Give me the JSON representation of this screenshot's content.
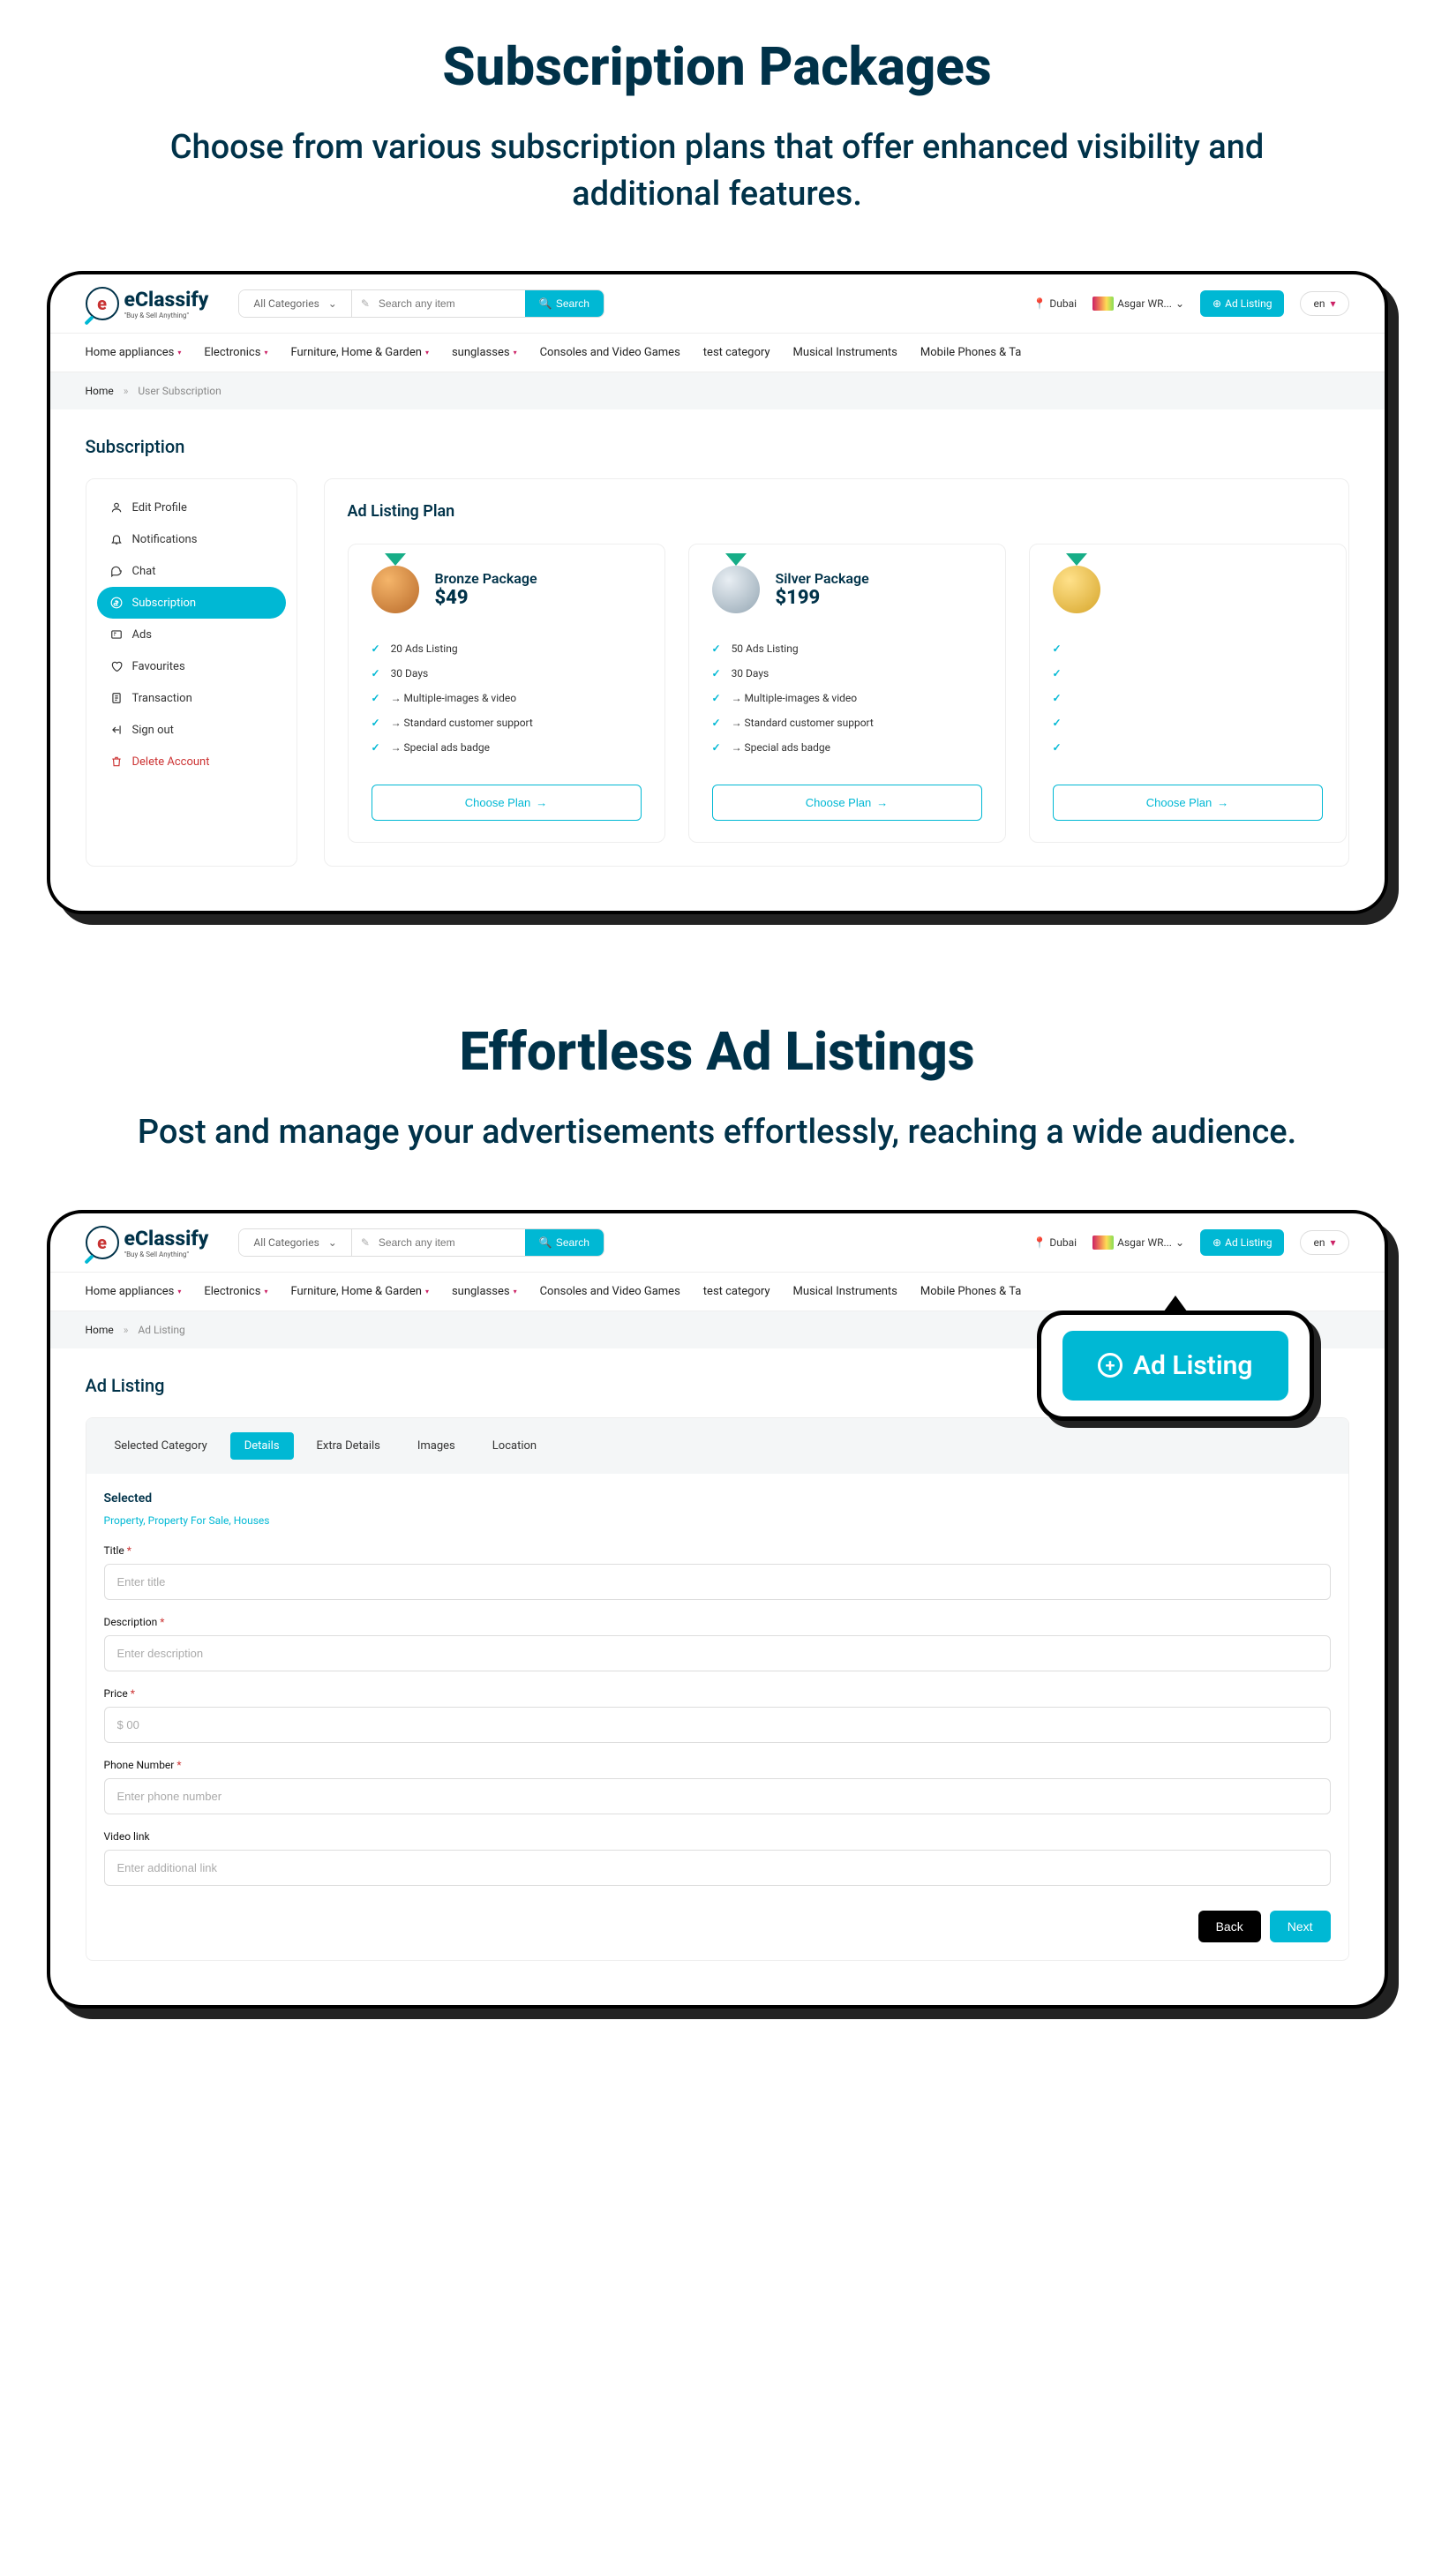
{
  "section1": {
    "title": "Subscription Packages",
    "subtitle": "Choose from various subscription plans that offer enhanced visibility and additional features."
  },
  "section2": {
    "title": "Effortless Ad Listings",
    "subtitle": "Post and manage your advertisements effortlessly, reaching a wide audience."
  },
  "brand": {
    "name": "eClassify",
    "tagline": "\"Buy & Sell Anything\""
  },
  "header": {
    "all_categories": "All Categories",
    "search_placeholder": "Search any item",
    "search_btn": "Search",
    "location": "Dubai",
    "user": "Asgar WR...",
    "ad_listing_btn": "Ad Listing",
    "lang": "en"
  },
  "nav": {
    "items": [
      "Home appliances",
      "Electronics",
      "Furniture, Home & Garden",
      "sunglasses",
      "Consoles and Video Games",
      "test category",
      "Musical Instruments",
      "Mobile Phones & Ta"
    ],
    "caret_indices": [
      0,
      1,
      2,
      3
    ]
  },
  "breadcrumb1": {
    "home": "Home",
    "current": "User Subscription"
  },
  "breadcrumb2": {
    "home": "Home",
    "current": "Ad Listing"
  },
  "page1": {
    "title": "Subscription",
    "sidebar": {
      "items": [
        {
          "icon": "user",
          "label": "Edit Profile"
        },
        {
          "icon": "bell",
          "label": "Notifications"
        },
        {
          "icon": "chat",
          "label": "Chat"
        },
        {
          "icon": "dollar",
          "label": "Subscription",
          "active": true
        },
        {
          "icon": "ads",
          "label": "Ads"
        },
        {
          "icon": "heart",
          "label": "Favourites"
        },
        {
          "icon": "doc",
          "label": "Transaction"
        },
        {
          "icon": "signout",
          "label": "Sign out"
        },
        {
          "icon": "trash",
          "label": "Delete Account",
          "danger": true
        }
      ]
    },
    "main": {
      "heading": "Ad Listing Plan",
      "choose_plan": "Choose Plan",
      "plans": [
        {
          "medal": "bronze",
          "name": "Bronze Package",
          "price": "$49",
          "features": [
            "20 Ads Listing",
            "30 Days",
            "→ Multiple-images & video",
            "→ Standard customer support",
            "→ Special ads badge"
          ]
        },
        {
          "medal": "silver",
          "name": "Silver Package",
          "price": "$199",
          "features": [
            "50 Ads Listing",
            "30 Days",
            "→ Multiple-images & video",
            "→ Standard customer support",
            "→ Special ads badge"
          ]
        },
        {
          "medal": "gold",
          "name": "",
          "price": "",
          "features": [
            "",
            "",
            "",
            "",
            ""
          ]
        }
      ]
    }
  },
  "page2": {
    "title": "Ad Listing",
    "callout_btn": "Ad Listing",
    "tabs": [
      "Selected Category",
      "Details",
      "Extra Details",
      "Images",
      "Location"
    ],
    "active_tab": 1,
    "selected_heading": "Selected",
    "selected_path": "Property, Property For Sale, Houses",
    "fields": [
      {
        "label": "Title",
        "required": true,
        "placeholder": "Enter title"
      },
      {
        "label": "Description",
        "required": true,
        "placeholder": "Enter description"
      },
      {
        "label": "Price",
        "required": true,
        "placeholder": "$ 00"
      },
      {
        "label": "Phone Number",
        "required": true,
        "placeholder": "Enter phone number"
      },
      {
        "label": "Video link",
        "required": false,
        "placeholder": "Enter additional link"
      }
    ],
    "back_btn": "Back",
    "next_btn": "Next"
  }
}
